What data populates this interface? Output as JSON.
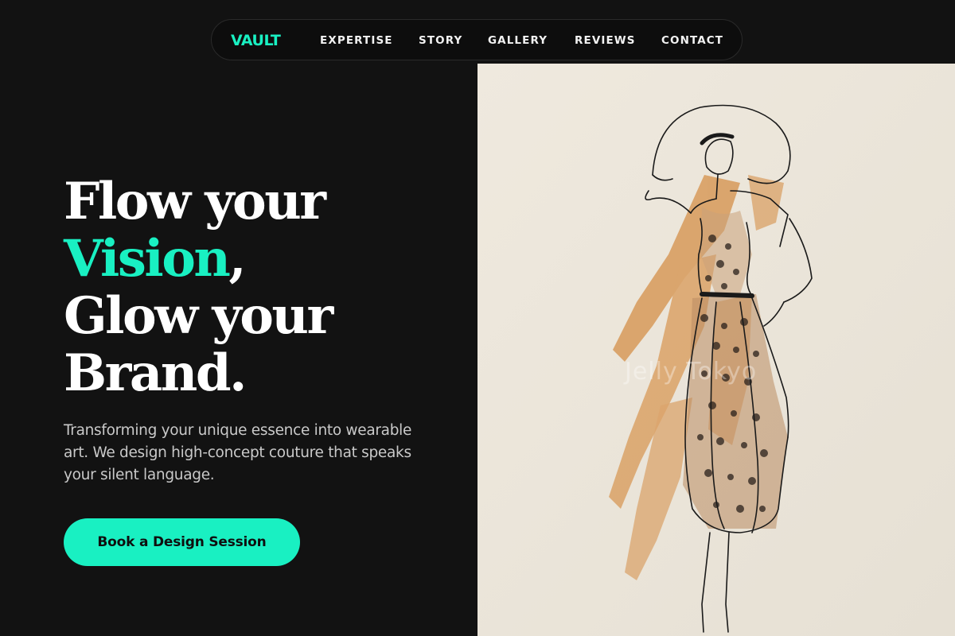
{
  "brand": {
    "logo": "VAULT",
    "accent_color": "#19f0c2",
    "background_color": "#121212"
  },
  "nav": {
    "links": [
      "EXPERTISE",
      "STORY",
      "GALLERY",
      "REVIEWS",
      "CONTACT"
    ]
  },
  "hero": {
    "headline": {
      "line1": "Flow your",
      "highlight": "Vision",
      "comma": ",",
      "line3": "Glow your",
      "line4": "Brand."
    },
    "subtitle": "Transforming your unique essence into wearable art. We design high-concept couture that speaks your silent language.",
    "cta_label": "Book a Design Session"
  },
  "image": {
    "subject": "fashion-sketch-illustration",
    "paper_color": "#ece6da",
    "wash_color": "#d89a5a",
    "ink_color": "#1a1a1a"
  }
}
